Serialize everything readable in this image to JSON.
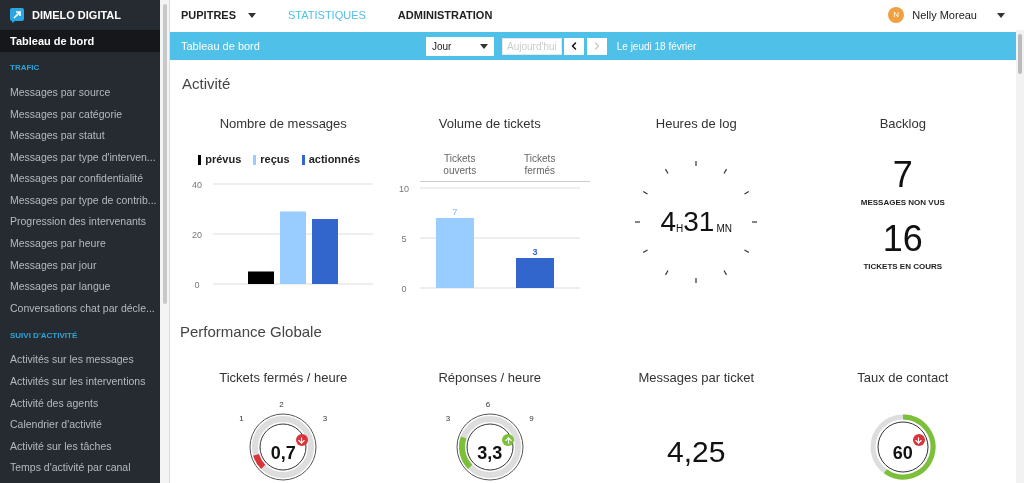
{
  "brand": "DIMELO DIGITAL",
  "sidebar": {
    "active": {
      "label": "Tableau de bord",
      "selected": true
    },
    "sections": [
      {
        "title": "TRAFIC",
        "items": [
          {
            "label": "Messages par source",
            "selected": false
          },
          {
            "label": "Messages par catégorie",
            "selected": false
          },
          {
            "label": "Messages par statut",
            "selected": false
          },
          {
            "label": "Messages par type d'interven...",
            "selected": false
          },
          {
            "label": "Messages par confidentialité",
            "selected": false
          },
          {
            "label": "Messages par type de contrib...",
            "selected": false
          },
          {
            "label": "Progression des intervenants",
            "selected": false
          },
          {
            "label": "Messages par heure",
            "selected": false
          },
          {
            "label": "Messages par jour",
            "selected": false
          },
          {
            "label": "Messages par langue",
            "selected": false
          },
          {
            "label": "Conversations chat par décle...",
            "selected": false
          }
        ]
      },
      {
        "title": "SUIVI D'ACTIVITÉ",
        "items": [
          {
            "label": "Activités sur les messages",
            "selected": false
          },
          {
            "label": "Activités sur les interventions",
            "selected": false
          },
          {
            "label": "Activité des agents",
            "selected": false
          },
          {
            "label": "Calendrier d'activité",
            "selected": false
          },
          {
            "label": "Activité sur les tâches",
            "selected": false
          },
          {
            "label": "Temps d'activité par canal",
            "selected": false
          }
        ]
      }
    ]
  },
  "nav": [
    {
      "label": "PUPITRES",
      "selected": false,
      "dropdown": true
    },
    {
      "label": "STATISTIQUES",
      "selected": true,
      "dropdown": false
    },
    {
      "label": "ADMINISTRATION",
      "selected": false,
      "dropdown": false
    }
  ],
  "user": {
    "initial": "N",
    "name": "Nelly Moreau"
  },
  "toolbar": {
    "title": "Tableau de bord",
    "period": "Jour",
    "today_button": {
      "label": "Aujourd'hui",
      "disabled": true
    },
    "prev_disabled": false,
    "next_disabled": true,
    "date": "Le jeudi 18 février"
  },
  "activity": {
    "title": "Activité",
    "messages": {
      "title": "Nombre de messages",
      "chart_data": {
        "type": "bar",
        "yticks": [
          0,
          20,
          40
        ],
        "ylim": [
          0,
          40
        ],
        "series": [
          {
            "name": "prévus",
            "color": "#000000",
            "values": [
              5
            ]
          },
          {
            "name": "reçus",
            "color": "#99ccff",
            "values": [
              29
            ]
          },
          {
            "name": "actionnés",
            "color": "#3366cc",
            "values": [
              26
            ]
          }
        ]
      }
    },
    "tickets": {
      "title": "Volume de tickets",
      "chart_data": {
        "type": "bar",
        "yticks": [
          0,
          5,
          10
        ],
        "ylim": [
          0,
          10
        ],
        "data_labels": true,
        "series": [
          {
            "name": "Tickets ouverts",
            "color": "#99ccff",
            "values": [
              7,
              null
            ]
          },
          {
            "name": "Tickets fermés",
            "color": "#3366cc",
            "values": [
              null,
              3
            ]
          }
        ]
      }
    },
    "log": {
      "title": "Heures de log",
      "hours": "4",
      "hours_unit": "H",
      "minutes": "31",
      "minutes_unit": "MN"
    },
    "backlog": {
      "title": "Backlog",
      "stats": [
        {
          "value": "7",
          "label": "MESSAGES NON VUS"
        },
        {
          "value": "16",
          "label": "TICKETS EN COURS"
        }
      ]
    }
  },
  "performance": {
    "title": "Performance Globale",
    "widgets": [
      {
        "kind": "dial",
        "title": "Tickets fermés / heure",
        "value": "0,7",
        "trend_up": false,
        "level": 0.08,
        "ticks": [
          "1",
          "2",
          "3"
        ]
      },
      {
        "kind": "dial",
        "title": "Réponses / heure",
        "value": "3,3",
        "trend_up": true,
        "level": 0.18,
        "ticks": [
          "3",
          "6",
          "9"
        ]
      },
      {
        "kind": "number",
        "title": "Messages par ticket",
        "value": "4,25"
      },
      {
        "kind": "ring",
        "title": "Taux de contact",
        "value": "60",
        "trend_up": false,
        "level": 0.6
      }
    ]
  }
}
